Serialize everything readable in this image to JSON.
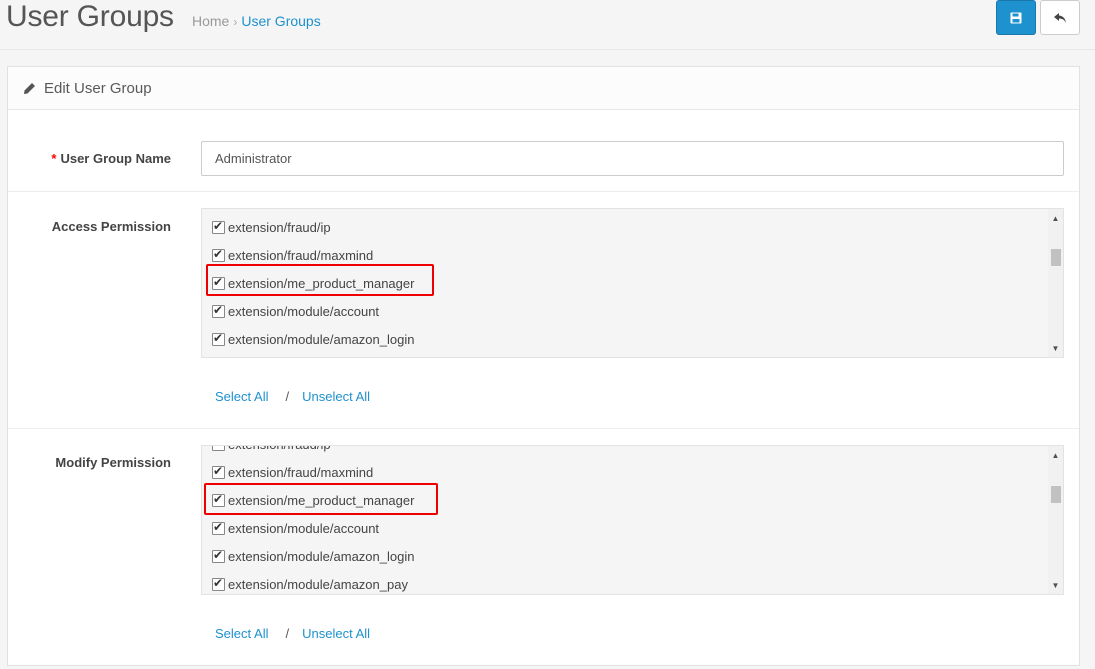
{
  "header": {
    "title": "User Groups",
    "breadcrumb": [
      "Home",
      "User Groups"
    ],
    "save_icon": "floppy-disk-icon",
    "back_icon": "reply-arrow-icon"
  },
  "panel": {
    "heading": "Edit User Group",
    "heading_icon": "pencil-icon"
  },
  "form": {
    "name_label": "User Group Name",
    "name_value": "Administrator",
    "access_label": "Access Permission",
    "modify_label": "Modify Permission",
    "select_all": "Select All",
    "separator": "/",
    "unselect_all": "Unselect All"
  },
  "access_items": [
    {
      "label": "extension/fraud/ip",
      "checked": true
    },
    {
      "label": "extension/fraud/maxmind",
      "checked": true
    },
    {
      "label": "extension/me_product_manager",
      "checked": true
    },
    {
      "label": "extension/module/account",
      "checked": true
    },
    {
      "label": "extension/module/amazon_login",
      "checked": true
    }
  ],
  "modify_items": [
    {
      "label": "extension/fraud/ip",
      "checked": false
    },
    {
      "label": "extension/fraud/maxmind",
      "checked": true
    },
    {
      "label": "extension/me_product_manager",
      "checked": true
    },
    {
      "label": "extension/module/account",
      "checked": true
    },
    {
      "label": "extension/module/amazon_login",
      "checked": true
    },
    {
      "label": "extension/module/amazon_pay",
      "checked": true
    }
  ],
  "colors": {
    "primary": "#1e91cf",
    "highlight": "#e00000",
    "required": "#ff0000"
  }
}
